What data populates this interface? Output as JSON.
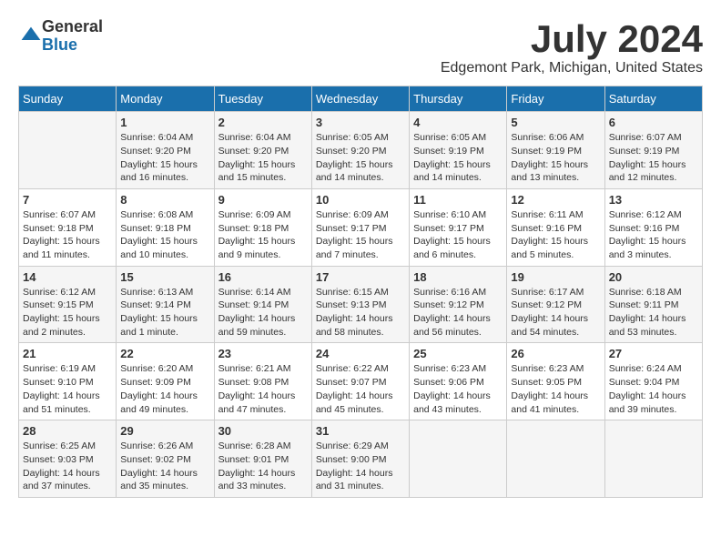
{
  "logo": {
    "general": "General",
    "blue": "Blue"
  },
  "title": {
    "month_year": "July 2024",
    "location": "Edgemont Park, Michigan, United States"
  },
  "headers": [
    "Sunday",
    "Monday",
    "Tuesday",
    "Wednesday",
    "Thursday",
    "Friday",
    "Saturday"
  ],
  "weeks": [
    [
      {
        "day": "",
        "info": ""
      },
      {
        "day": "1",
        "info": "Sunrise: 6:04 AM\nSunset: 9:20 PM\nDaylight: 15 hours\nand 16 minutes."
      },
      {
        "day": "2",
        "info": "Sunrise: 6:04 AM\nSunset: 9:20 PM\nDaylight: 15 hours\nand 15 minutes."
      },
      {
        "day": "3",
        "info": "Sunrise: 6:05 AM\nSunset: 9:20 PM\nDaylight: 15 hours\nand 14 minutes."
      },
      {
        "day": "4",
        "info": "Sunrise: 6:05 AM\nSunset: 9:19 PM\nDaylight: 15 hours\nand 14 minutes."
      },
      {
        "day": "5",
        "info": "Sunrise: 6:06 AM\nSunset: 9:19 PM\nDaylight: 15 hours\nand 13 minutes."
      },
      {
        "day": "6",
        "info": "Sunrise: 6:07 AM\nSunset: 9:19 PM\nDaylight: 15 hours\nand 12 minutes."
      }
    ],
    [
      {
        "day": "7",
        "info": "Sunrise: 6:07 AM\nSunset: 9:18 PM\nDaylight: 15 hours\nand 11 minutes."
      },
      {
        "day": "8",
        "info": "Sunrise: 6:08 AM\nSunset: 9:18 PM\nDaylight: 15 hours\nand 10 minutes."
      },
      {
        "day": "9",
        "info": "Sunrise: 6:09 AM\nSunset: 9:18 PM\nDaylight: 15 hours\nand 9 minutes."
      },
      {
        "day": "10",
        "info": "Sunrise: 6:09 AM\nSunset: 9:17 PM\nDaylight: 15 hours\nand 7 minutes."
      },
      {
        "day": "11",
        "info": "Sunrise: 6:10 AM\nSunset: 9:17 PM\nDaylight: 15 hours\nand 6 minutes."
      },
      {
        "day": "12",
        "info": "Sunrise: 6:11 AM\nSunset: 9:16 PM\nDaylight: 15 hours\nand 5 minutes."
      },
      {
        "day": "13",
        "info": "Sunrise: 6:12 AM\nSunset: 9:16 PM\nDaylight: 15 hours\nand 3 minutes."
      }
    ],
    [
      {
        "day": "14",
        "info": "Sunrise: 6:12 AM\nSunset: 9:15 PM\nDaylight: 15 hours\nand 2 minutes."
      },
      {
        "day": "15",
        "info": "Sunrise: 6:13 AM\nSunset: 9:14 PM\nDaylight: 15 hours\nand 1 minute."
      },
      {
        "day": "16",
        "info": "Sunrise: 6:14 AM\nSunset: 9:14 PM\nDaylight: 14 hours\nand 59 minutes."
      },
      {
        "day": "17",
        "info": "Sunrise: 6:15 AM\nSunset: 9:13 PM\nDaylight: 14 hours\nand 58 minutes."
      },
      {
        "day": "18",
        "info": "Sunrise: 6:16 AM\nSunset: 9:12 PM\nDaylight: 14 hours\nand 56 minutes."
      },
      {
        "day": "19",
        "info": "Sunrise: 6:17 AM\nSunset: 9:12 PM\nDaylight: 14 hours\nand 54 minutes."
      },
      {
        "day": "20",
        "info": "Sunrise: 6:18 AM\nSunset: 9:11 PM\nDaylight: 14 hours\nand 53 minutes."
      }
    ],
    [
      {
        "day": "21",
        "info": "Sunrise: 6:19 AM\nSunset: 9:10 PM\nDaylight: 14 hours\nand 51 minutes."
      },
      {
        "day": "22",
        "info": "Sunrise: 6:20 AM\nSunset: 9:09 PM\nDaylight: 14 hours\nand 49 minutes."
      },
      {
        "day": "23",
        "info": "Sunrise: 6:21 AM\nSunset: 9:08 PM\nDaylight: 14 hours\nand 47 minutes."
      },
      {
        "day": "24",
        "info": "Sunrise: 6:22 AM\nSunset: 9:07 PM\nDaylight: 14 hours\nand 45 minutes."
      },
      {
        "day": "25",
        "info": "Sunrise: 6:23 AM\nSunset: 9:06 PM\nDaylight: 14 hours\nand 43 minutes."
      },
      {
        "day": "26",
        "info": "Sunrise: 6:23 AM\nSunset: 9:05 PM\nDaylight: 14 hours\nand 41 minutes."
      },
      {
        "day": "27",
        "info": "Sunrise: 6:24 AM\nSunset: 9:04 PM\nDaylight: 14 hours\nand 39 minutes."
      }
    ],
    [
      {
        "day": "28",
        "info": "Sunrise: 6:25 AM\nSunset: 9:03 PM\nDaylight: 14 hours\nand 37 minutes."
      },
      {
        "day": "29",
        "info": "Sunrise: 6:26 AM\nSunset: 9:02 PM\nDaylight: 14 hours\nand 35 minutes."
      },
      {
        "day": "30",
        "info": "Sunrise: 6:28 AM\nSunset: 9:01 PM\nDaylight: 14 hours\nand 33 minutes."
      },
      {
        "day": "31",
        "info": "Sunrise: 6:29 AM\nSunset: 9:00 PM\nDaylight: 14 hours\nand 31 minutes."
      },
      {
        "day": "",
        "info": ""
      },
      {
        "day": "",
        "info": ""
      },
      {
        "day": "",
        "info": ""
      }
    ]
  ]
}
